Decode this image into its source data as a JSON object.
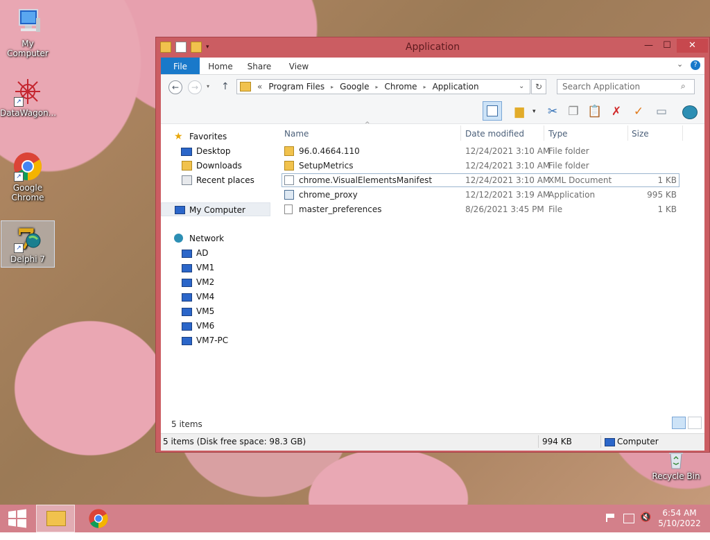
{
  "desktop": {
    "icons": [
      {
        "label": "My Computer"
      },
      {
        "label": "DataWagon..."
      },
      {
        "label": "Google Chrome"
      },
      {
        "label": "Delphi 7"
      },
      {
        "label": "Recycle Bin"
      }
    ]
  },
  "window": {
    "title": "Application",
    "minimize": "—",
    "maximize": "☐",
    "close": "✕"
  },
  "ribbon": {
    "tabs": [
      "File",
      "Home",
      "Share",
      "View"
    ]
  },
  "navbar": {
    "back": "←",
    "forward": "→",
    "up": "↑",
    "breadcrumb_prefix": "«",
    "breadcrumb": [
      "Program Files",
      "Google",
      "Chrome",
      "Application"
    ],
    "refresh": "↻",
    "search_placeholder": "Search Application"
  },
  "sidebar": {
    "favorites": {
      "label": "Favorites",
      "items": [
        "Desktop",
        "Downloads",
        "Recent places"
      ]
    },
    "computer": "My Computer",
    "network": {
      "label": "Network",
      "items": [
        "AD",
        "VM1",
        "VM2",
        "VM4",
        "VM5",
        "VM6",
        "VM7-PC"
      ]
    }
  },
  "columns": [
    "Name",
    "Date modified",
    "Type",
    "Size"
  ],
  "files": [
    {
      "name": "96.0.4664.110",
      "date": "12/24/2021 3:10 AM",
      "type": "File folder",
      "size": "",
      "icon": "folder-icon"
    },
    {
      "name": "SetupMetrics",
      "date": "12/24/2021 3:10 AM",
      "type": "File folder",
      "size": "",
      "icon": "folder-icon"
    },
    {
      "name": "chrome.VisualElementsManifest",
      "date": "12/24/2021 3:10 AM",
      "type": "XML Document",
      "size": "1 KB",
      "icon": "xml-file-icon"
    },
    {
      "name": "chrome_proxy",
      "date": "12/12/2021 3:19 AM",
      "type": "Application",
      "size": "995 KB",
      "icon": "application-icon"
    },
    {
      "name": "master_preferences",
      "date": "8/26/2021 3:45 PM",
      "type": "File",
      "size": "1 KB",
      "icon": "file-icon"
    }
  ],
  "item_count": "5 items",
  "status": {
    "left": "5 items (Disk free space: 98.3 GB)",
    "size": "994 KB",
    "location": "Computer"
  },
  "taskbar": {
    "time": "6:54 AM",
    "date": "5/10/2022"
  }
}
